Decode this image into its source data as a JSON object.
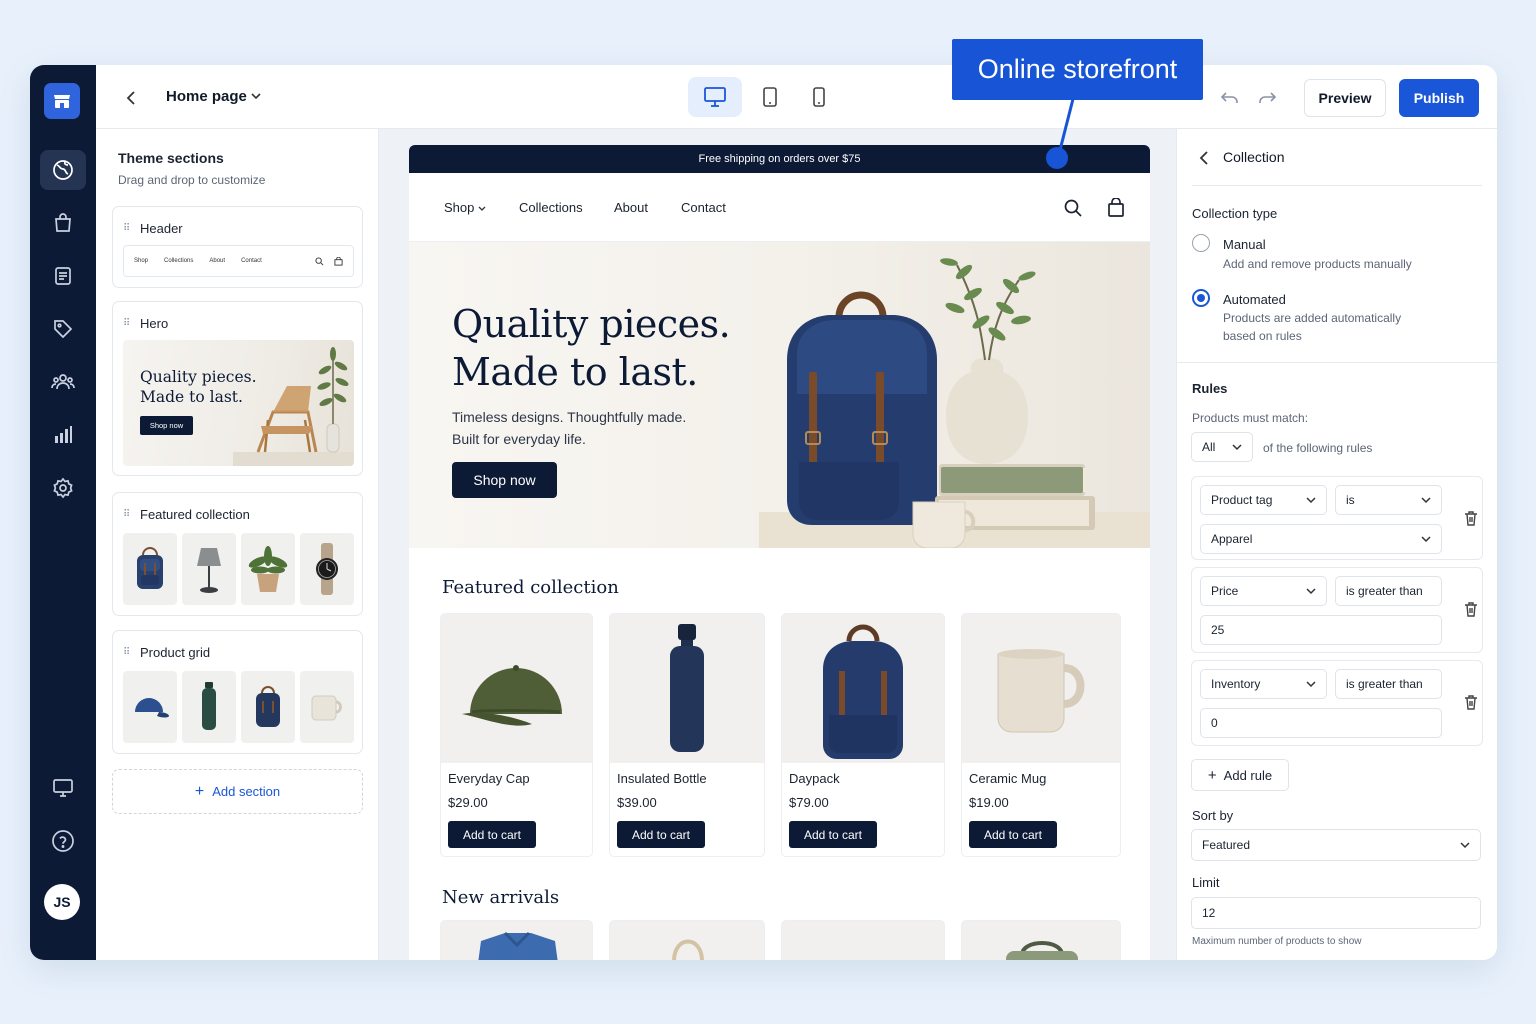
{
  "callout": {
    "text": "Online storefront"
  },
  "topbar": {
    "page_title": "Home page",
    "preview_label": "Preview",
    "publish_label": "Publish"
  },
  "rail": {
    "items": [
      "storefront-icon",
      "shopping-bag-icon",
      "document-icon",
      "tag-icon",
      "users-icon",
      "analytics-icon",
      "settings-icon"
    ],
    "bottom": [
      "monitor-icon",
      "help-icon"
    ],
    "avatar_initials": "JS"
  },
  "sidebar": {
    "title": "Theme sections",
    "subtitle": "Drag and drop to customize",
    "sections": {
      "header": {
        "label": "Header",
        "nav": [
          "Shop",
          "Collections",
          "About",
          "Contact"
        ]
      },
      "hero": {
        "label": "Hero",
        "headline_1": "Quality pieces.",
        "headline_2": "Made to last.",
        "button": "Shop now"
      },
      "featured": {
        "label": "Featured collection"
      },
      "grid": {
        "label": "Product grid"
      }
    },
    "add_section_label": "Add section"
  },
  "store": {
    "announcement": "Free shipping on orders over $75",
    "nav": {
      "shop": "Shop",
      "collections": "Collections",
      "about": "About",
      "contact": "Contact"
    },
    "hero": {
      "line1": "Quality pieces.",
      "line2": "Made to last.",
      "body1": "Timeless designs. Thoughtfully made.",
      "body2": "Built for everyday life.",
      "button": "Shop now"
    },
    "featured_title": "Featured collection",
    "products": [
      {
        "name": "Everyday Cap",
        "price": "$29.00",
        "button": "Add to cart"
      },
      {
        "name": "Insulated Bottle",
        "price": "$39.00",
        "button": "Add to cart"
      },
      {
        "name": "Daypack",
        "price": "$79.00",
        "button": "Add to cart"
      },
      {
        "name": "Ceramic Mug",
        "price": "$19.00",
        "button": "Add to cart"
      }
    ],
    "new_arrivals_title": "New arrivals"
  },
  "panel": {
    "title": "Collection",
    "collection_type_label": "Collection type",
    "manual_label": "Manual",
    "manual_desc": "Add and remove products manually",
    "automated_label": "Automated",
    "automated_desc_1": "Products are added automatically",
    "automated_desc_2": "based on rules",
    "selected_type": "Automated",
    "rules_label": "Rules",
    "must_match_label": "Products must match:",
    "match_value": "All",
    "match_suffix": "of the following rules",
    "rules": [
      {
        "field": "Product tag",
        "operator": "is",
        "value": "Apparel"
      },
      {
        "field": "Price",
        "operator": "is greater than",
        "value": "25"
      },
      {
        "field": "Inventory",
        "operator": "is greater than",
        "value": "0"
      }
    ],
    "add_rule_label": "Add rule",
    "sort_label": "Sort by",
    "sort_value": "Featured",
    "limit_label": "Limit",
    "limit_value": "12",
    "limit_help": "Maximum number of products to show"
  },
  "colors": {
    "accent": "#1a56d8",
    "navy": "#0c1a36",
    "background": "#e8f1fb"
  }
}
